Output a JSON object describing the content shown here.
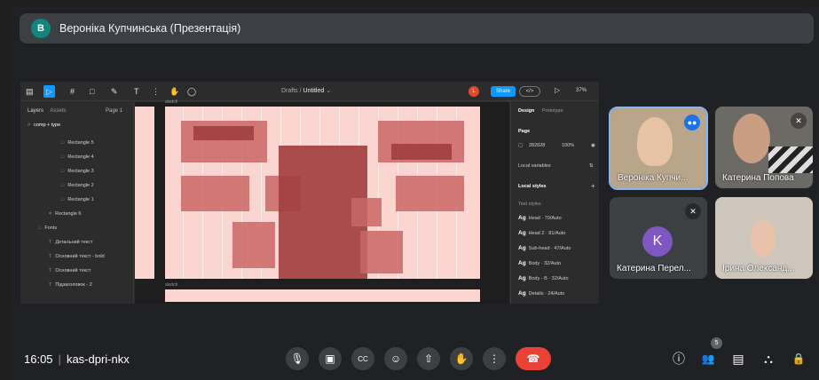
{
  "presenter": {
    "initial": "B",
    "label": "Вероніка Купчинська (Презентація)"
  },
  "figma": {
    "breadcrumb": "Drafts",
    "file_name": "Untitled",
    "user_initial": "L",
    "share_label": "Share",
    "dev_label": "</>",
    "zoom": "37%",
    "layers_tab": "Layers",
    "assets_tab": "Assets",
    "page_label": "Page 1",
    "layers": [
      "comp + type",
      "Rectangle 5",
      "Rectangle 4",
      "Rectangle 3",
      "Rectangle 2",
      "Rectangle 1",
      "Rectangle 6",
      "Fonts",
      "Детальний текст",
      "Основний текст - bold",
      "Основний текст",
      "Підзаголовок - 2"
    ],
    "frame_label": "sketch",
    "frame_label_2": "sketch",
    "design_tab": "Design",
    "prototype_tab": "Prototype",
    "page_section": "Page",
    "page_color": "282828",
    "page_opacity": "100%",
    "local_variables": "Local variables",
    "local_styles": "Local styles",
    "text_styles": "Text styles",
    "styles": [
      "Head · 70/Auto",
      "Head 2 · 81/Auto",
      "Sub-head · 47/Auto",
      "Body · 32/Auto",
      "Body - B · 32/Auto",
      "Details · 24/Auto"
    ],
    "ag": "Ag"
  },
  "participants": [
    {
      "name": "Вероніка Купчи...",
      "status": "speaking"
    },
    {
      "name": "Катерина Попова",
      "status": "muted"
    },
    {
      "name": "Катерина Перел...",
      "initial": "K",
      "status": "muted"
    },
    {
      "name": "Ірина Олександ...",
      "status": "none"
    }
  ],
  "meeting": {
    "time": "16:05",
    "code": "kas-dpri-nkx",
    "people_count": "5"
  },
  "icons": {
    "mic": "🎙",
    "camera": "▣",
    "captions": "CC",
    "emoji": "☺",
    "present": "⇧",
    "hand": "✋",
    "more": "⋮",
    "end": "☎",
    "info": "ⓘ",
    "people": "👥",
    "chat": "▤",
    "activities": "⛬",
    "lock": "🔒"
  },
  "colors": {
    "accent": "#8ab4f8",
    "end_call": "#ea4335",
    "figma_blue": "#0d99ff"
  }
}
